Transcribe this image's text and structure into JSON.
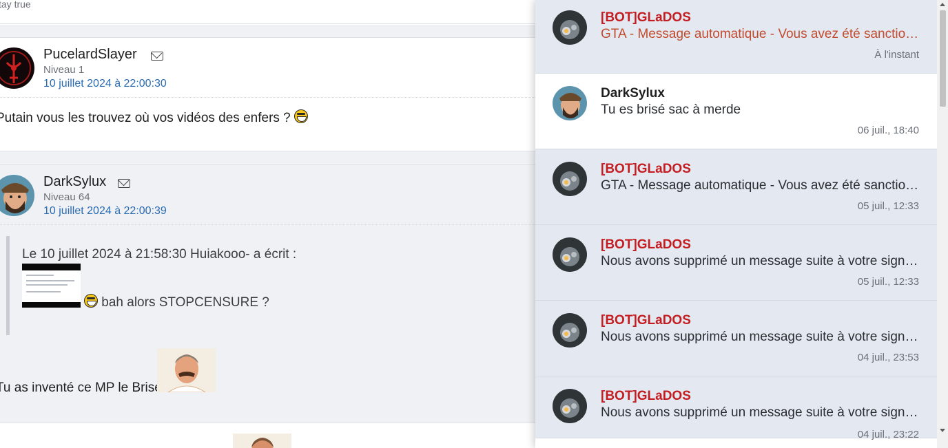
{
  "forum": {
    "top_fragment": "tay true",
    "posts": [
      {
        "username": "PucelardSlayer",
        "level": "Niveau 1",
        "date": "10 juillet 2024 à 22:00:30",
        "body": "Putain vous les trouvez où vos vidéos des enfers ?"
      },
      {
        "username": "DarkSylux",
        "level": "Niveau 64",
        "date": "10 juillet 2024 à 22:00:39",
        "quote_header": "Le 10 juillet 2024 à 21:58:30 Huiakooo- a écrit :",
        "quote_text": "bah alors STOPCENSURE ?",
        "body": "Tu as inventé ce MP le Brisé"
      }
    ]
  },
  "notifications": [
    {
      "sender": "[BOT]GLaDOS",
      "message": "GTA - Message automatique - Vous avez été sanctionné",
      "time": "À l'instant"
    },
    {
      "sender": "DarkSylux",
      "message": "Tu es brisé sac à merde",
      "time": "06 juil., 18:40"
    },
    {
      "sender": "[BOT]GLaDOS",
      "message": "GTA - Message automatique - Vous avez été sanctionné",
      "time": "05 juil., 12:33"
    },
    {
      "sender": "[BOT]GLaDOS",
      "message": "Nous avons supprimé un message suite à votre signalement",
      "time": "05 juil., 12:33"
    },
    {
      "sender": "[BOT]GLaDOS",
      "message": "Nous avons supprimé un message suite à votre signalement",
      "time": "04 juil., 23:53"
    },
    {
      "sender": "[BOT]GLaDOS",
      "message": "Nous avons supprimé un message suite à votre signalement",
      "time": "04 juil., 23:22"
    }
  ]
}
